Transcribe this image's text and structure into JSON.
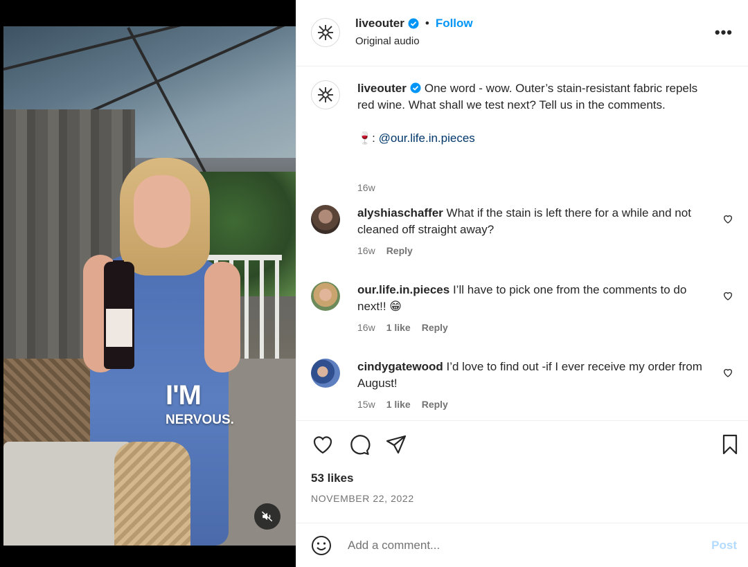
{
  "video": {
    "overlay_big": "I'M",
    "overlay_small": "NERVOUS."
  },
  "header": {
    "username": "liveouter",
    "separator": "•",
    "follow_label": "Follow",
    "audio_label": "Original audio",
    "more_label": "•••"
  },
  "caption": {
    "username": "liveouter",
    "text": "One word - wow. Outer’s stain-resistant fabric repels red wine. What shall we test next? Tell us in the comments.",
    "credit_emoji": "🍷",
    "credit_sep": ": ",
    "credit_mention": "@our.life.in.pieces",
    "time": "16w"
  },
  "comments": [
    {
      "username": "alyshiaschaffer",
      "text": "What if the stain is left there for a while and not cleaned off straight away?",
      "time": "16w",
      "likes": "",
      "reply": "Reply"
    },
    {
      "username": "our.life.in.pieces",
      "text": "I’ll have to pick one from the comments to do next!! 😁",
      "time": "16w",
      "likes": "1 like",
      "reply": "Reply"
    },
    {
      "username": "cindygatewood",
      "text": "I’d love to find out -if I ever receive my order from August!",
      "time": "15w",
      "likes": "1 like",
      "reply": "Reply"
    }
  ],
  "engagement": {
    "likes": "53 likes",
    "date": "NOVEMBER 22, 2022"
  },
  "add_comment": {
    "placeholder": "Add a comment...",
    "post_label": "Post"
  },
  "icons": {
    "brand_logo": "outer-logo-icon",
    "verified": "verified-badge-icon",
    "like": "heart-icon",
    "comment": "comment-bubble-icon",
    "share": "paper-plane-icon",
    "save": "bookmark-icon",
    "emoji": "smiley-icon",
    "mute": "speaker-muted-icon"
  },
  "colors": {
    "accent": "#0095f6",
    "mention": "#00376b",
    "secondary_text": "#737373",
    "post_disabled": "#b3dbff",
    "verified": "#0095f6"
  }
}
